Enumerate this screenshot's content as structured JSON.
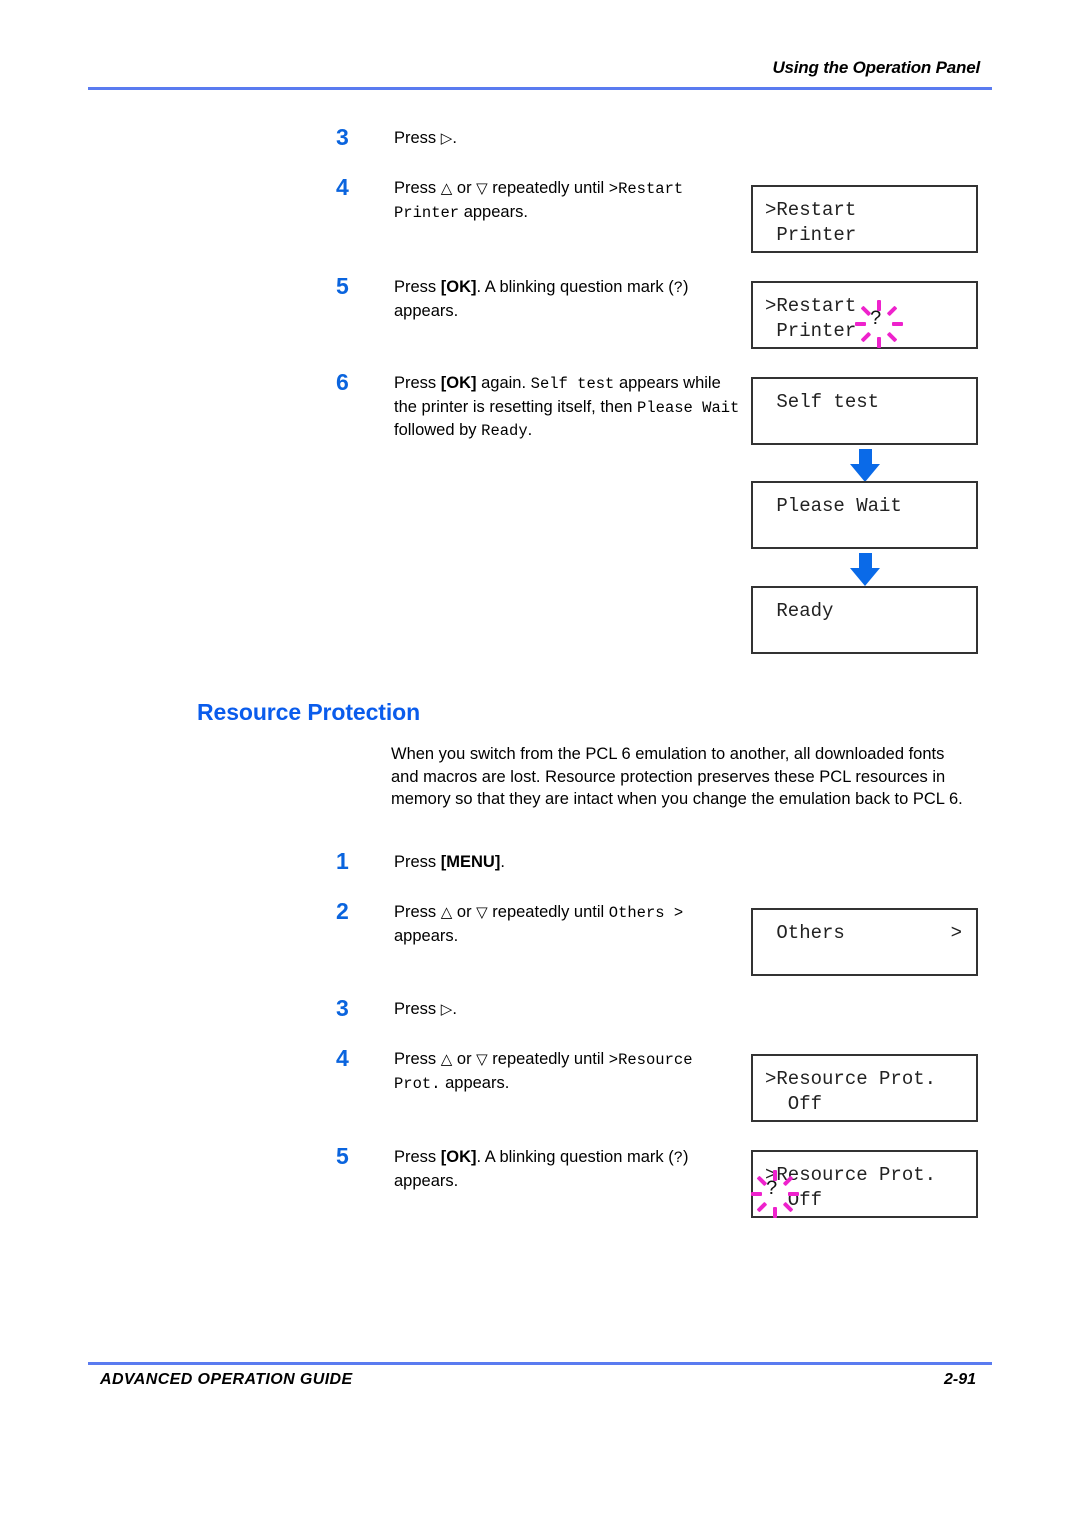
{
  "header": {
    "title": "Using the Operation Panel"
  },
  "footer": {
    "guide_label": "ADVANCED OPERATION GUIDE",
    "page_number": "2-91"
  },
  "colors": {
    "rule_blue": "#5a7bf0",
    "step_number_blue": "#0a64de",
    "heading_blue": "#0a5cec",
    "arrow_blue": "#0a6ae8",
    "blink_magenta": "#ee22cc",
    "lcd_border": "#333333"
  },
  "steps_top": [
    {
      "number": "3",
      "text_parts": [
        {
          "style": "plain",
          "text": "Press "
        },
        {
          "style": "glyph",
          "text": "▷"
        },
        {
          "style": "plain",
          "text": "."
        }
      ]
    },
    {
      "number": "4",
      "text_parts": [
        {
          "style": "plain",
          "text": "Press "
        },
        {
          "style": "glyph",
          "text": "△"
        },
        {
          "style": "plain",
          "text": " or "
        },
        {
          "style": "glyph",
          "text": "▽"
        },
        {
          "style": "plain",
          "text": " repeatedly until "
        },
        {
          "style": "mono",
          "text": ">Restart Printer"
        },
        {
          "style": "plain",
          "text": " appears."
        }
      ]
    },
    {
      "number": "5",
      "text_parts": [
        {
          "style": "plain",
          "text": "Press "
        },
        {
          "style": "bold",
          "text": "[OK]"
        },
        {
          "style": "plain",
          "text": ". A blinking question mark ("
        },
        {
          "style": "mono",
          "text": "?"
        },
        {
          "style": "plain",
          "text": ") appears."
        }
      ]
    },
    {
      "number": "6",
      "text_parts": [
        {
          "style": "plain",
          "text": "Press "
        },
        {
          "style": "bold",
          "text": "[OK]"
        },
        {
          "style": "plain",
          "text": " again. "
        },
        {
          "style": "mono",
          "text": "Self test"
        },
        {
          "style": "plain",
          "text": " appears while the printer is resetting itself, then "
        },
        {
          "style": "mono",
          "text": "Please Wait"
        },
        {
          "style": "plain",
          "text": " followed by "
        },
        {
          "style": "mono",
          "text": "Ready"
        },
        {
          "style": "plain",
          "text": "."
        }
      ]
    }
  ],
  "section": {
    "heading": "Resource Protection",
    "paragraph": "When you switch from the PCL 6 emulation to another, all downloaded fonts and macros are lost. Resource protection preserves these PCL resources in memory so that they are intact when you change the emulation back to PCL 6."
  },
  "steps_bottom": [
    {
      "number": "1",
      "text_parts": [
        {
          "style": "plain",
          "text": "Press "
        },
        {
          "style": "bold",
          "text": "[MENU]"
        },
        {
          "style": "plain",
          "text": "."
        }
      ]
    },
    {
      "number": "2",
      "text_parts": [
        {
          "style": "plain",
          "text": "Press "
        },
        {
          "style": "glyph",
          "text": "△"
        },
        {
          "style": "plain",
          "text": " or "
        },
        {
          "style": "glyph",
          "text": "▽"
        },
        {
          "style": "plain",
          "text": " repeatedly until "
        },
        {
          "style": "mono",
          "text": "Others >"
        },
        {
          "style": "plain",
          "text": " appears."
        }
      ]
    },
    {
      "number": "3",
      "text_parts": [
        {
          "style": "plain",
          "text": "Press "
        },
        {
          "style": "glyph",
          "text": "▷"
        },
        {
          "style": "plain",
          "text": "."
        }
      ]
    },
    {
      "number": "4",
      "text_parts": [
        {
          "style": "plain",
          "text": "Press "
        },
        {
          "style": "glyph",
          "text": "△"
        },
        {
          "style": "plain",
          "text": " or "
        },
        {
          "style": "glyph",
          "text": "▽"
        },
        {
          "style": "plain",
          "text": " repeatedly until "
        },
        {
          "style": "mono",
          "text": ">Resource Prot."
        },
        {
          "style": "plain",
          "text": " appears."
        }
      ]
    },
    {
      "number": "5",
      "text_parts": [
        {
          "style": "plain",
          "text": "Press "
        },
        {
          "style": "bold",
          "text": "[OK]"
        },
        {
          "style": "plain",
          "text": ". A blinking question mark ("
        },
        {
          "style": "mono",
          "text": "?"
        },
        {
          "style": "plain",
          "text": ") appears."
        }
      ]
    }
  ],
  "lcd_panels": {
    "restart_printer": {
      "line1": ">Restart",
      "line2": " Printer"
    },
    "restart_printer_q": {
      "line1": ">Restart",
      "line2": " Printer",
      "blink_mark": "?"
    },
    "self_test": {
      "line1": " Self test",
      "line2": ""
    },
    "please_wait": {
      "line1": " Please Wait",
      "line2": ""
    },
    "ready": {
      "line1": " Ready",
      "line2": ""
    },
    "others": {
      "line1_left": " Others",
      "line1_right": ">",
      "line2": ""
    },
    "resource_prot_off": {
      "line1": ">Resource Prot.",
      "line2": "  Off"
    },
    "resource_prot_off_q": {
      "line1": ">Resource Prot.",
      "line2": "  Off",
      "blink_mark": "?"
    }
  }
}
